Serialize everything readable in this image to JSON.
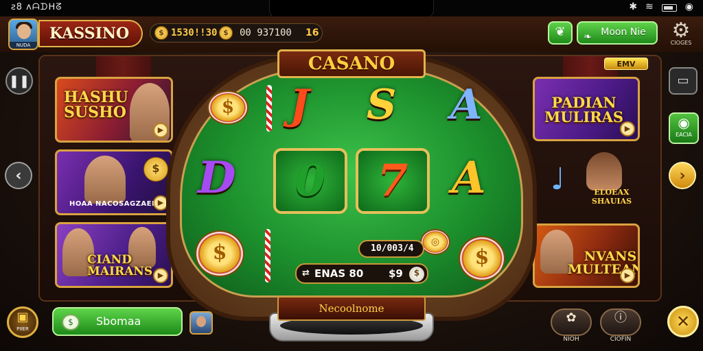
{
  "status_bar": {
    "left_text": "ꙅ8 ʌᗩᗪᕼᘔ",
    "signal_icon": "signal-icon",
    "right_icons": [
      "bluetooth-icon",
      "wifi-icon",
      "battery-icon",
      "dot-icon"
    ]
  },
  "header": {
    "avatar_tag": "NUDA",
    "brand": "KASSINO",
    "balance_primary": "1530!!30",
    "balance_secondary": "00 937100",
    "balance_level": "16",
    "gift_icon": "gift-icon",
    "mode_button": "Moon Nie",
    "settings_label": "CIOGES"
  },
  "table": {
    "sign": "CASANO",
    "symbols": {
      "top": [
        "J",
        "S",
        "A"
      ],
      "mid_left": "D",
      "reels": [
        "0",
        "7"
      ],
      "mid_right": "A"
    },
    "win_value": "10/003/4",
    "bet_label": "ENAS 80",
    "bet_value": "$9",
    "spin_label": "Necoolnome"
  },
  "left_cards": [
    {
      "title": "HASHU\nSUSHO",
      "subtitle": ""
    },
    {
      "title": "",
      "subtitle": "HOAA NACOSAGZAEK"
    },
    {
      "title": "CIAND\nMAIRANS",
      "subtitle": ""
    }
  ],
  "right_cards": [
    {
      "badge": "EMV",
      "title": "PADIAN\nMULIRAS"
    },
    {
      "title": "ELOEAX\nSHAUIAS"
    },
    {
      "title": "NVANS\nMULTEANS"
    }
  ],
  "side_controls": {
    "camera_label": "EACIA"
  },
  "bottom_bar": {
    "shop_label": "PIIER",
    "bonus_label": "Sbomaa",
    "btn1_label": "NIOH",
    "btn2_label": "CIOFIN"
  },
  "colors": {
    "felt": "#1c8f2c",
    "gold": "#e0b44c",
    "brand_red": "#9c2614",
    "green_button": "#2a9a22"
  }
}
